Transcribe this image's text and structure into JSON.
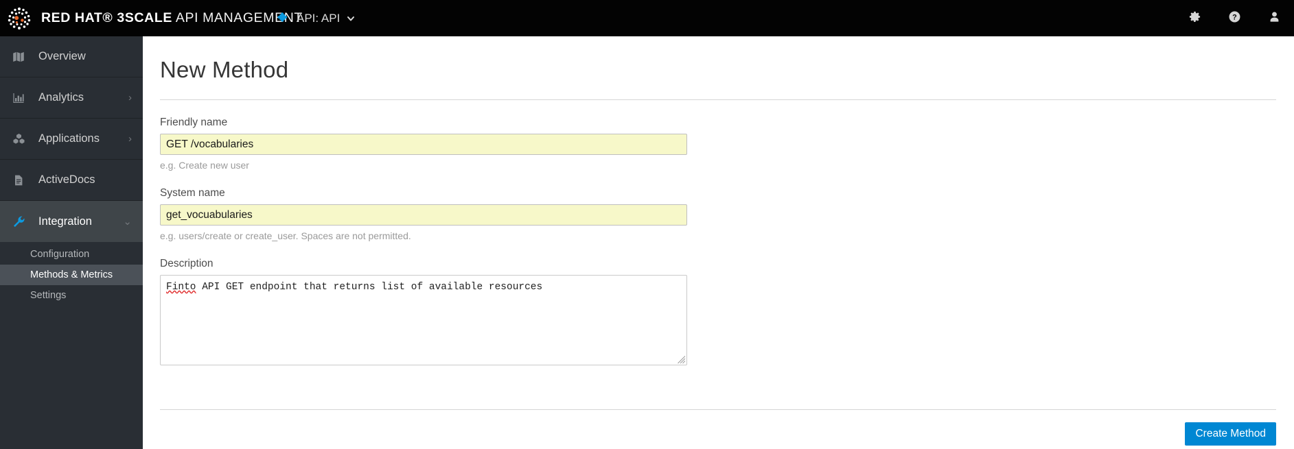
{
  "masthead": {
    "logo_icon": "redhat-dot-logo",
    "brand_bold": "RED HAT® 3SCALE",
    "brand_light": "API MANAGEMENT",
    "api_switcher": {
      "icon": "puzzle-piece-icon",
      "label": "API: API",
      "caret_icon": "chevron-down-icon"
    },
    "tools": [
      {
        "name": "settings-button",
        "icon": "gear-icon"
      },
      {
        "name": "help-button",
        "icon": "question-circle-icon"
      },
      {
        "name": "account-button",
        "icon": "user-icon"
      }
    ]
  },
  "sidebar": {
    "items": [
      {
        "label": "Overview",
        "icon": "map-icon",
        "caret": "",
        "active": false
      },
      {
        "label": "Analytics",
        "icon": "bar-chart-icon",
        "caret": "›",
        "active": false
      },
      {
        "label": "Applications",
        "icon": "cubes-icon",
        "caret": "›",
        "active": false
      },
      {
        "label": "ActiveDocs",
        "icon": "file-text-icon",
        "caret": "",
        "active": false
      },
      {
        "label": "Integration",
        "icon": "wrench-icon",
        "caret": "⌄",
        "active": true
      }
    ],
    "subitems": [
      {
        "label": "Configuration",
        "active": false
      },
      {
        "label": "Methods & Metrics",
        "active": true
      },
      {
        "label": "Settings",
        "active": false
      }
    ]
  },
  "main": {
    "title": "New Method",
    "fields": {
      "friendly_name": {
        "label": "Friendly name",
        "value": "GET /vocabularies",
        "help": "e.g. Create new user"
      },
      "system_name": {
        "label": "System name",
        "value": "get_vocuabularies",
        "help": "e.g. users/create or create_user. Spaces are not permitted."
      },
      "description": {
        "label": "Description",
        "value": "Finto API GET endpoint that returns list of available resources",
        "misspelled_word": "Finto",
        "value_rest": " API GET endpoint that returns list of available resources"
      }
    },
    "submit_label": "Create Method"
  },
  "colors": {
    "accent_blue": "#0087d3",
    "masthead_bg": "#030303",
    "sidebar_bg": "#292e34",
    "autofill_yellow": "#f7f8c9"
  }
}
